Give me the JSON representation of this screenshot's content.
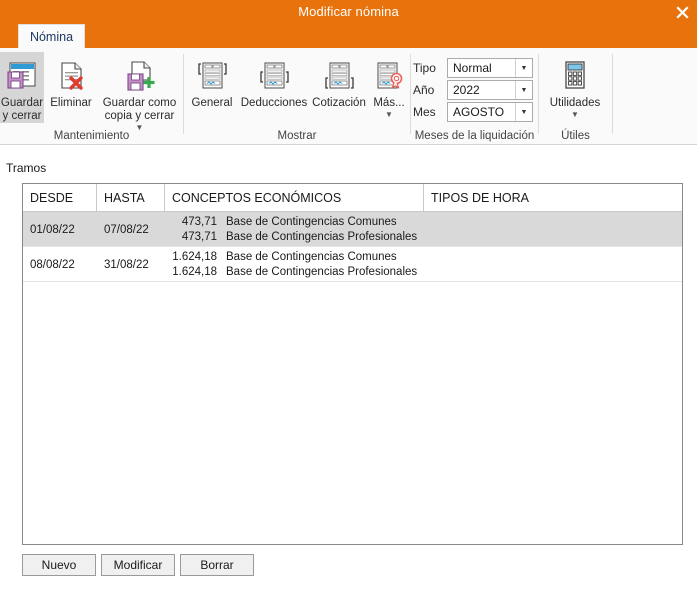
{
  "window": {
    "title": "Modificar nómina",
    "close_icon": "close-icon",
    "accent_color": "#E8730C"
  },
  "ribbon": {
    "tabs": [
      {
        "label": "Nómina",
        "active": true
      }
    ],
    "groups": [
      {
        "name": "Mantenimiento",
        "label": "Mantenimiento",
        "buttons": [
          {
            "id": "guardar-y-cerrar",
            "label": "Guardar\ny cerrar",
            "icon": "save-table-icon",
            "selected": true,
            "has_caret": false
          },
          {
            "id": "eliminar",
            "label": "Eliminar",
            "icon": "document-delete-icon",
            "selected": false,
            "has_caret": false
          },
          {
            "id": "guardar-como-copia-y-cerrar",
            "label": "Guardar como\ncopia y cerrar",
            "icon": "save-copy-icon",
            "selected": false,
            "has_caret": true
          }
        ]
      },
      {
        "name": "Mostrar",
        "label": "Mostrar",
        "buttons": [
          {
            "id": "general",
            "label": "General",
            "icon": "document-general-icon",
            "selected": false,
            "has_caret": false
          },
          {
            "id": "deducciones",
            "label": "Deducciones",
            "icon": "document-deductions-icon",
            "selected": false,
            "has_caret": false
          },
          {
            "id": "cotizacion",
            "label": "Cotización",
            "icon": "document-contribution-icon",
            "selected": false,
            "has_caret": false
          },
          {
            "id": "mas",
            "label": "Más...",
            "icon": "document-award-icon",
            "selected": false,
            "has_caret": true
          }
        ]
      },
      {
        "name": "Meses de la liquidación",
        "label": "Meses de la liquidación",
        "fields": [
          {
            "id": "tipo",
            "label": "Tipo",
            "value": "Normal"
          },
          {
            "id": "anio",
            "label": "Año",
            "value": "2022"
          },
          {
            "id": "mes",
            "label": "Mes",
            "value": "AGOSTO"
          }
        ]
      },
      {
        "name": "Útiles",
        "label": "Útiles",
        "buttons": [
          {
            "id": "utilidades",
            "label": "Utilidades",
            "icon": "calculator-icon",
            "selected": false,
            "has_caret": true
          }
        ]
      }
    ]
  },
  "content": {
    "section_label": "Tramos",
    "table": {
      "columns": [
        {
          "key": "desde",
          "label": "DESDE"
        },
        {
          "key": "hasta",
          "label": "HASTA"
        },
        {
          "key": "conceptos",
          "label": "CONCEPTOS ECONÓMICOS"
        },
        {
          "key": "tipos_hora",
          "label": "TIPOS DE HORA"
        }
      ],
      "rows": [
        {
          "selected": true,
          "desde": "01/08/22",
          "hasta": "07/08/22",
          "conceptos": [
            {
              "amount": "473,71",
              "description": "Base de Contingencias Comunes"
            },
            {
              "amount": "473,71",
              "description": "Base de Contingencias Profesionales"
            }
          ],
          "tipos_hora": ""
        },
        {
          "selected": false,
          "desde": "08/08/22",
          "hasta": "31/08/22",
          "conceptos": [
            {
              "amount": "1.624,18",
              "description": "Base de Contingencias Comunes"
            },
            {
              "amount": "1.624,18",
              "description": "Base de Contingencias Profesionales"
            }
          ],
          "tipos_hora": ""
        }
      ]
    }
  },
  "footer": {
    "buttons": [
      {
        "id": "nuevo",
        "label": "Nuevo"
      },
      {
        "id": "modificar",
        "label": "Modificar"
      },
      {
        "id": "borrar",
        "label": "Borrar"
      }
    ]
  }
}
